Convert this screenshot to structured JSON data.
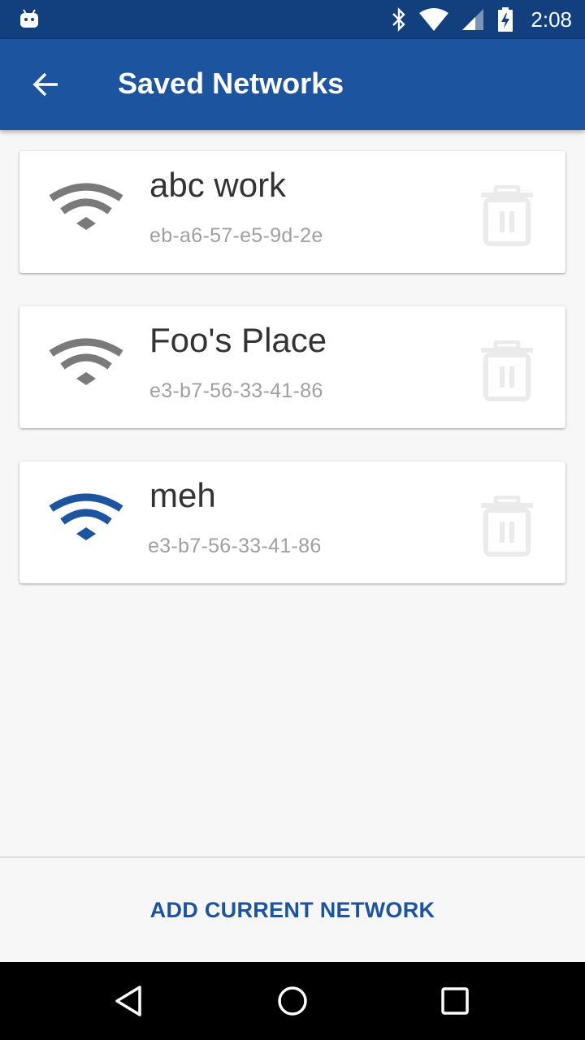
{
  "status_bar": {
    "time": "2:08",
    "icons": [
      "android-debug-icon",
      "bluetooth-icon",
      "wifi-signal-icon",
      "cell-signal-icon",
      "battery-charging-icon"
    ]
  },
  "app_bar": {
    "title": "Saved Networks",
    "back_icon": "arrow-back-icon"
  },
  "networks": [
    {
      "name": "abc work",
      "mac": "eb-a6-57-e5-9d-2e",
      "active": false
    },
    {
      "name": "Foo's Place",
      "mac": "e3-b7-56-33-41-86",
      "active": false
    },
    {
      "name": "meh",
      "mac": "e3-b7-56-33-41-86",
      "active": true
    }
  ],
  "footer": {
    "add_button_label": "ADD CURRENT NETWORK"
  },
  "colors": {
    "primary": "#1d549f",
    "primary_dark": "#123f7d",
    "wifi_inactive": "#7a7a7a",
    "wifi_active": "#1d549f",
    "trash": "#ebebeb"
  },
  "nav_bar": {
    "icons": [
      "back-triangle-icon",
      "home-circle-icon",
      "recents-square-icon"
    ]
  }
}
